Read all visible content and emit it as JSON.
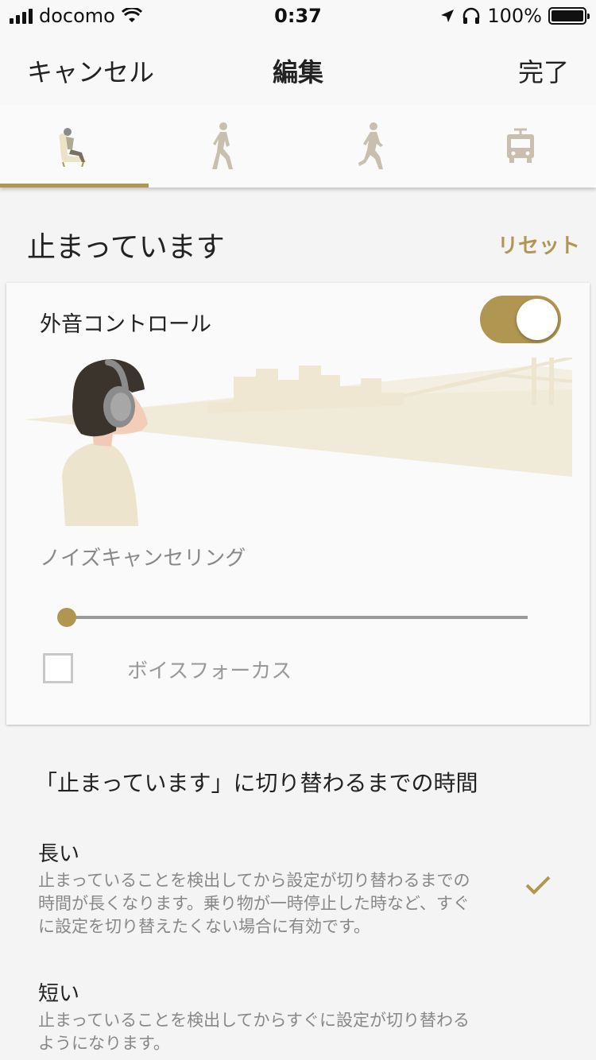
{
  "status_bar": {
    "carrier": "docomo",
    "time": "0:37",
    "battery": "100%",
    "battery_level": 1.0
  },
  "nav": {
    "cancel": "キャンセル",
    "title": "編集",
    "done": "完了"
  },
  "tabs": [
    {
      "icon": "sitting-person-icon",
      "selected": true
    },
    {
      "icon": "walking-person-icon",
      "selected": false
    },
    {
      "icon": "running-person-icon",
      "selected": false
    },
    {
      "icon": "train-icon",
      "selected": false
    }
  ],
  "section": {
    "title": "止まっています",
    "reset": "リセット"
  },
  "card": {
    "ambient_control_label": "外音コントロール",
    "ambient_control_on": true,
    "noise_cancelling_label": "ノイズキャンセリング",
    "slider_level": 0,
    "voice_focus_label": "ボイスフォーカス",
    "voice_focus_checked": false
  },
  "timing": {
    "title": "「止まっています」に切り替わるまでの時間",
    "options": [
      {
        "title": "長い",
        "desc": "止まっていることを検出してから設定が切り替わるまでの時間が長くなります。乗り物が一時停止した時など、すぐに設定を切り替えたくない場合に有効です。",
        "selected": true
      },
      {
        "title": "短い",
        "desc": "止まっていることを検出してからすぐに設定が切り替わるようになります。",
        "selected": false
      }
    ]
  },
  "colors": {
    "accent": "#b09650",
    "background": "#f4f4f4",
    "card": "#fafafa",
    "icon_inactive": "#c9bfae"
  }
}
